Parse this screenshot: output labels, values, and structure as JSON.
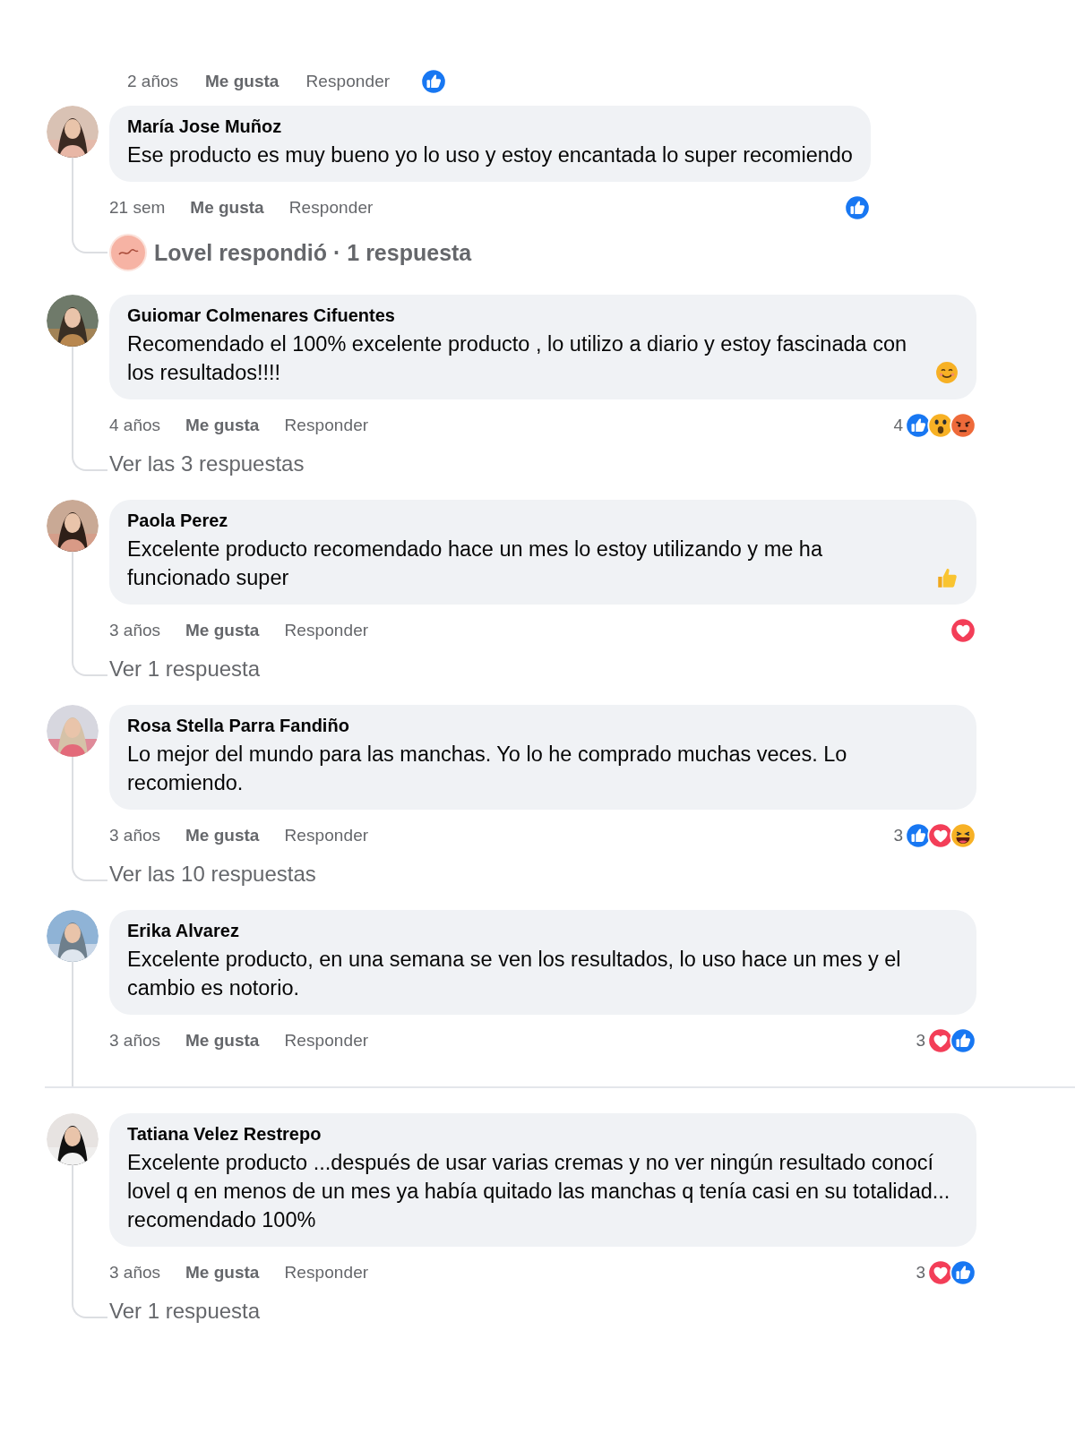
{
  "top_meta": {
    "time": "2 años",
    "like": "Me gusta",
    "reply": "Responder",
    "reactions": {
      "icons": [
        {
          "kind": "like"
        }
      ]
    }
  },
  "comments": [
    {
      "author": "María Jose Muñoz",
      "text": "Ese producto es muy bueno yo lo uso y estoy encantada lo super recomiendo",
      "time": "21 sem",
      "like": "Me gusta",
      "reply": "Responder",
      "reactions": {
        "icons": [
          {
            "kind": "like"
          }
        ]
      },
      "replies_link": {
        "kind": "author_reply",
        "text": "Lovel respondió · 1 respuesta"
      },
      "separated": false
    },
    {
      "author": "Guiomar Colmenares Cifuentes",
      "text": "Recomendado el 100% excelente producto , lo utilizo a diario y estoy fascinada con los resultados!!!!",
      "emoji": {
        "kind": "smile"
      },
      "time": "4 años",
      "like": "Me gusta",
      "reply": "Responder",
      "reactions": {
        "count": "4",
        "icons": [
          {
            "kind": "like"
          },
          {
            "kind": "wow"
          },
          {
            "kind": "angry"
          }
        ]
      },
      "replies_link": {
        "kind": "count",
        "text": "Ver las 3 respuestas"
      },
      "separated": false
    },
    {
      "author": "Paola Perez",
      "text": "Excelente producto recomendado hace un mes lo estoy utilizando y me ha funcionado super",
      "emoji": {
        "kind": "thumbs_up"
      },
      "time": "3 años",
      "like": "Me gusta",
      "reply": "Responder",
      "reactions": {
        "icons": [
          {
            "kind": "love"
          }
        ]
      },
      "replies_link": {
        "kind": "count",
        "text": "Ver 1 respuesta"
      },
      "separated": false
    },
    {
      "author": "Rosa Stella Parra Fandiño",
      "text": "Lo mejor del mundo para las manchas. Yo lo he comprado muchas veces. Lo recomiendo.",
      "time": "3 años",
      "like": "Me gusta",
      "reply": "Responder",
      "reactions": {
        "count": "3",
        "icons": [
          {
            "kind": "like"
          },
          {
            "kind": "love"
          },
          {
            "kind": "haha"
          }
        ]
      },
      "replies_link": {
        "kind": "count",
        "text": "Ver las 10 respuestas"
      },
      "separated": false
    },
    {
      "author": "Erika Alvarez",
      "text": "Excelente producto, en una semana se ven los resultados, lo uso hace un mes y el cambio es notorio.",
      "time": "3 años",
      "like": "Me gusta",
      "reply": "Responder",
      "reactions": {
        "count": "3",
        "icons": [
          {
            "kind": "love"
          },
          {
            "kind": "like"
          }
        ]
      },
      "separated": false
    },
    {
      "author": "Tatiana Velez Restrepo",
      "text": "Excelente producto ...después de usar varias cremas y no ver ningún resultado conocí lovel q en menos de un mes ya había quitado las manchas q tenía casi en su totalidad... recomendado 100%",
      "time": "3 años",
      "like": "Me gusta",
      "reply": "Responder",
      "reactions": {
        "count": "3",
        "icons": [
          {
            "kind": "love"
          },
          {
            "kind": "like"
          }
        ]
      },
      "replies_link": {
        "kind": "count",
        "text": "Ver 1 respuesta"
      },
      "separated": true
    }
  ]
}
